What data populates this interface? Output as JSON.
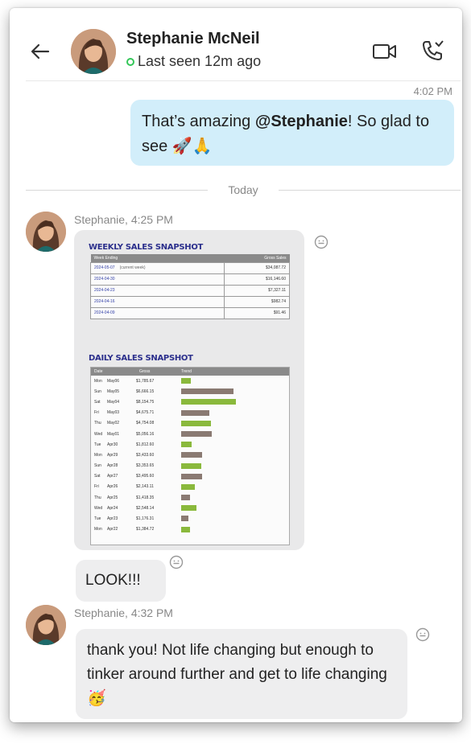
{
  "contact": {
    "name": "Stephanie McNeil",
    "status": "Last seen 12m ago"
  },
  "outgoing": {
    "time": "4:02 PM",
    "text_before": "That’s amazing ",
    "mention": "@Stephanie",
    "text_after": "! So glad to see 🚀🙏"
  },
  "day_separator": "Today",
  "incoming": [
    {
      "sender": "Stephanie, 4:25 PM"
    },
    {
      "sender": "Stephanie, 4:32 PM"
    }
  ],
  "messages": {
    "look": "LOOK!!!",
    "thank_you": "thank you! Not life changing but enough to tinker around further and get to life changing 🥳"
  },
  "screenshot": {
    "weekly_title": "WEEKLY SALES SNAPSHOT",
    "weekly_headers": [
      "Week Ending",
      "Gross Sales"
    ],
    "weekly_rows": [
      {
        "date": "2024-05-07",
        "note": "(current week)",
        "value": "$34,087.72"
      },
      {
        "date": "2024-04-30",
        "note": "",
        "value": "$16,146.60"
      },
      {
        "date": "2024-04-23",
        "note": "",
        "value": "$7,327.11"
      },
      {
        "date": "2024-04-16",
        "note": "",
        "value": "$982.74"
      },
      {
        "date": "2024-04-09",
        "note": "",
        "value": "$91.46"
      }
    ],
    "daily_title": "DAILY SALES SNAPSHOT",
    "daily_headers": [
      "Date",
      "Gross",
      "Trend"
    ],
    "bar_colors": {
      "green": "#8ab93c",
      "brown": "#8a7a72"
    },
    "daily_rows": [
      {
        "day": "Mon",
        "date": "May06",
        "gross": "$1,785.67",
        "trend": 0.1,
        "color": "green"
      },
      {
        "day": "Sun",
        "date": "May05",
        "gross": "$6,666.15",
        "trend": 0.55,
        "color": "brown"
      },
      {
        "day": "Sat",
        "date": "May04",
        "gross": "$8,154.75",
        "trend": 0.58,
        "color": "green"
      },
      {
        "day": "Fri",
        "date": "May03",
        "gross": "$4,675.71",
        "trend": 0.3,
        "color": "brown"
      },
      {
        "day": "Thu",
        "date": "May02",
        "gross": "$4,754.08",
        "trend": 0.31,
        "color": "green"
      },
      {
        "day": "Wed",
        "date": "May01",
        "gross": "$5,056.16",
        "trend": 0.32,
        "color": "brown"
      },
      {
        "day": "Tue",
        "date": "Apr30",
        "gross": "$1,812.60",
        "trend": 0.11,
        "color": "green"
      },
      {
        "day": "Mon",
        "date": "Apr29",
        "gross": "$3,433.60",
        "trend": 0.22,
        "color": "brown"
      },
      {
        "day": "Sun",
        "date": "Apr28",
        "gross": "$3,353.65",
        "trend": 0.21,
        "color": "green"
      },
      {
        "day": "Sat",
        "date": "Apr27",
        "gross": "$3,495.60",
        "trend": 0.22,
        "color": "brown"
      },
      {
        "day": "Fri",
        "date": "Apr26",
        "gross": "$2,143.11",
        "trend": 0.14,
        "color": "green"
      },
      {
        "day": "Thu",
        "date": "Apr25",
        "gross": "$1,418.35",
        "trend": 0.09,
        "color": "brown"
      },
      {
        "day": "Wed",
        "date": "Apr24",
        "gross": "$2,548.14",
        "trend": 0.16,
        "color": "green"
      },
      {
        "day": "Tue",
        "date": "Apr23",
        "gross": "$1,176.31",
        "trend": 0.08,
        "color": "brown"
      },
      {
        "day": "Mon",
        "date": "Apr22",
        "gross": "$1,384.72",
        "trend": 0.09,
        "color": "green"
      }
    ]
  },
  "colors": {
    "outgoing_bubble": "#d2eefa",
    "incoming_bubble": "#eeeeef",
    "online": "#34c759"
  },
  "icons": [
    "back-arrow-icon",
    "video-call-icon",
    "phone-call-icon",
    "add-reaction-icon"
  ]
}
